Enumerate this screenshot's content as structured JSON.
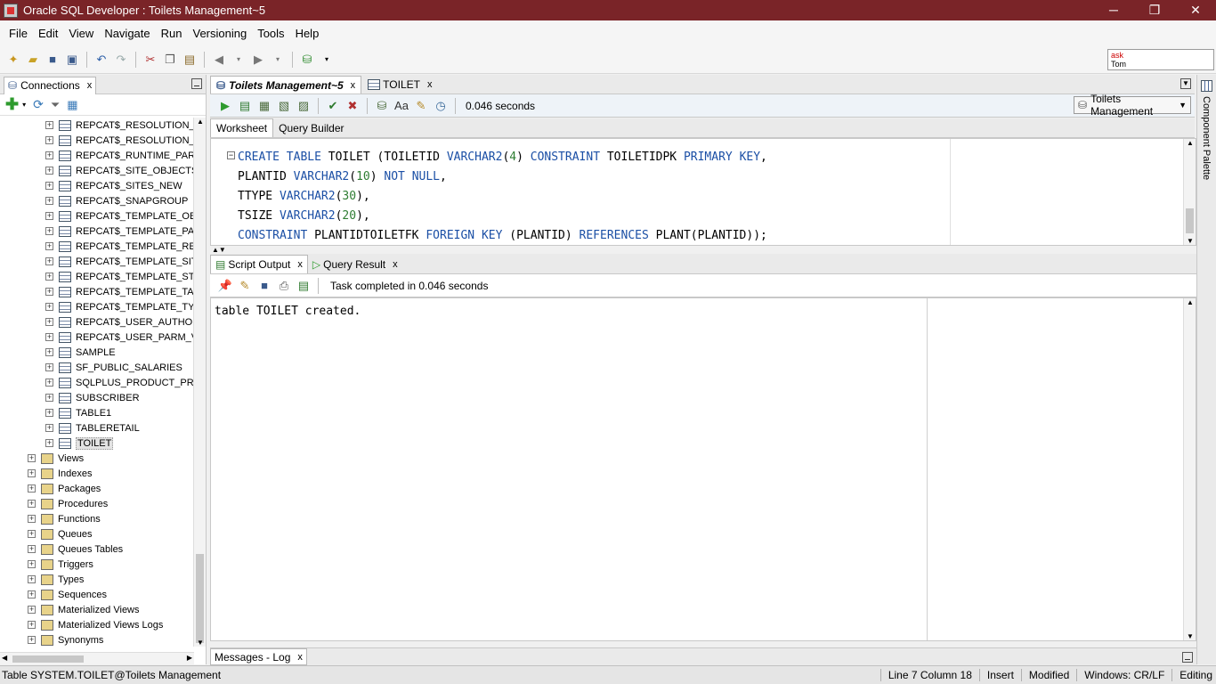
{
  "window": {
    "title": "Oracle SQL Developer : Toilets Management~5",
    "minimize": "─",
    "restore": "❐",
    "close": "✕"
  },
  "menu": [
    "File",
    "Edit",
    "View",
    "Navigate",
    "Run",
    "Versioning",
    "Tools",
    "Help"
  ],
  "asktom": {
    "line1": "ask",
    "line2": "Tom"
  },
  "connections": {
    "tab_label": "Connections",
    "close": "x",
    "tree_tables": [
      "REPCAT$_RESOLUTION_M",
      "REPCAT$_RESOLUTION_S",
      "REPCAT$_RUNTIME_PARM",
      "REPCAT$_SITE_OBJECTS",
      "REPCAT$_SITES_NEW",
      "REPCAT$_SNAPGROUP",
      "REPCAT$_TEMPLATE_OBJE",
      "REPCAT$_TEMPLATE_PARM",
      "REPCAT$_TEMPLATE_REFG",
      "REPCAT$_TEMPLATE_SITE",
      "REPCAT$_TEMPLATE_STAT",
      "REPCAT$_TEMPLATE_TARG",
      "REPCAT$_TEMPLATE_TYPE",
      "REPCAT$_USER_AUTHORI",
      "REPCAT$_USER_PARM_VA",
      "SAMPLE",
      "SF_PUBLIC_SALARIES",
      "SQLPLUS_PRODUCT_PROF",
      "SUBSCRIBER",
      "TABLE1",
      "TABLERETAIL",
      "TOILET"
    ],
    "tree_folders": [
      "Views",
      "Indexes",
      "Packages",
      "Procedures",
      "Functions",
      "Queues",
      "Queues Tables",
      "Triggers",
      "Types",
      "Sequences",
      "Materialized Views",
      "Materialized Views Logs",
      "Synonyms"
    ]
  },
  "editor": {
    "tabs": [
      {
        "label": "Toilets Management~5",
        "close": "x"
      },
      {
        "label": "TOILET",
        "close": "x"
      }
    ],
    "exec_time": "0.046 seconds",
    "connection": "Toilets Management",
    "subtabs": [
      "Worksheet",
      "Query Builder"
    ]
  },
  "output": {
    "tabs": [
      {
        "label": "Script Output",
        "close": "x"
      },
      {
        "label": "Query Result",
        "close": "x"
      }
    ],
    "status": "Task completed in 0.046 seconds",
    "text": "table TOILET created."
  },
  "messages": {
    "label": "Messages - Log",
    "close": "x"
  },
  "palette": {
    "label": "Component Palette"
  },
  "statusbar": {
    "left": "Table SYSTEM.TOILET@Toilets Management",
    "position": "Line 7 Column 18",
    "mode": "Insert",
    "modified": "Modified",
    "eol": "Windows: CR/LF",
    "editing": "Editing"
  }
}
